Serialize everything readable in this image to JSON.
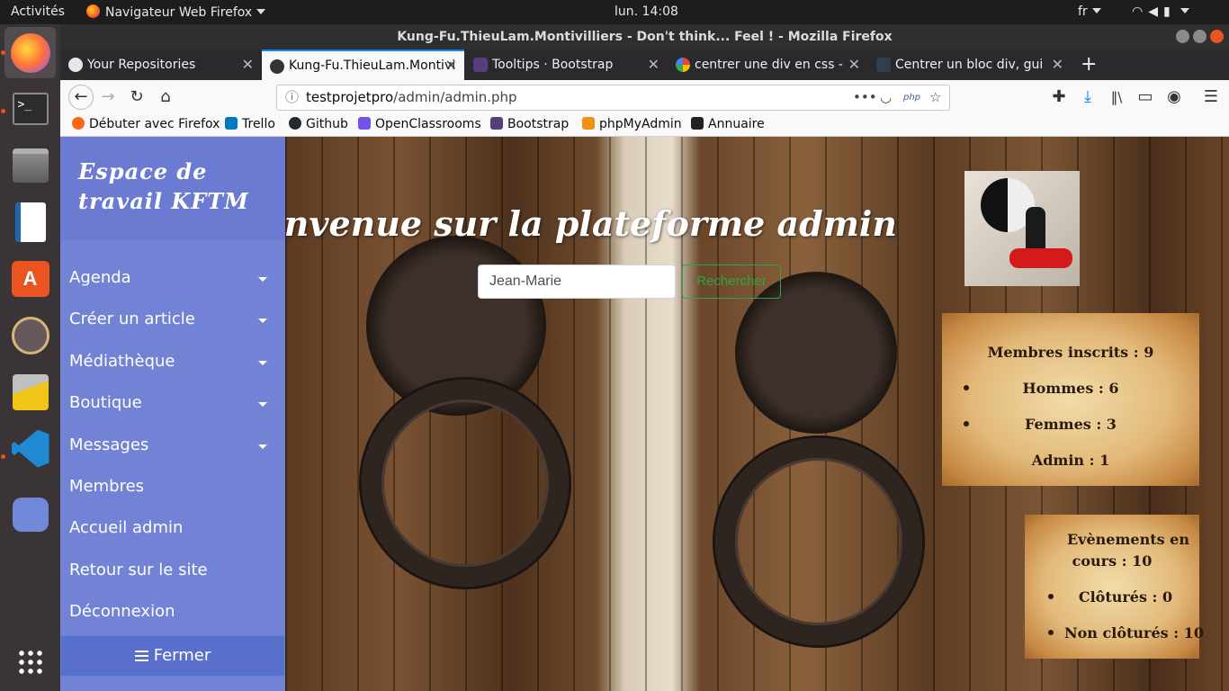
{
  "system": {
    "activities": "Activités",
    "app_menu": "Navigateur Web Firefox",
    "clock": "lun. 14:08",
    "keyboard_layout": "fr"
  },
  "dock": {
    "items": [
      "firefox-icon",
      "terminal-icon",
      "files-icon",
      "writer-icon",
      "software-icon",
      "atom-icon",
      "cleaner-icon",
      "vscode-icon",
      "discord-icon",
      "app-grid-icon"
    ]
  },
  "window": {
    "title": "Kung-Fu.ThieuLam.Montivilliers - Don't think... Feel ! - Mozilla Firefox"
  },
  "tabs": [
    {
      "label": "Your Repositories",
      "icon": "github-icon"
    },
    {
      "label": "Kung-Fu.ThieuLam.Montivi",
      "icon": "site-icon"
    },
    {
      "label": "Tooltips · Bootstrap",
      "icon": "bootstrap-icon"
    },
    {
      "label": "centrer une div en css - R",
      "icon": "google-icon"
    },
    {
      "label": "Centrer un bloc div, guide",
      "icon": "doc-icon"
    }
  ],
  "url": {
    "domain": "testprojetpro",
    "path": "/admin/admin.php"
  },
  "bookmarks": [
    {
      "label": "Débuter avec Firefox",
      "color": "#ff6611"
    },
    {
      "label": "Trello",
      "color": "#0079bf"
    },
    {
      "label": "Github",
      "color": "#24292e"
    },
    {
      "label": "OpenClassrooms",
      "color": "#7451eb"
    },
    {
      "label": "Bootstrap",
      "color": "#563d7c"
    },
    {
      "label": "phpMyAdmin",
      "color": "#f29111"
    },
    {
      "label": "Annuaire",
      "color": "#222222"
    }
  ],
  "sidebar": {
    "title_line1": "Espace de",
    "title_line2": "travail KFTM",
    "items": [
      {
        "label": "Agenda",
        "dropdown": true
      },
      {
        "label": "Créer un article",
        "dropdown": true
      },
      {
        "label": "Médiathèque",
        "dropdown": true
      },
      {
        "label": "Boutique",
        "dropdown": true
      },
      {
        "label": "Messages",
        "dropdown": true
      },
      {
        "label": "Membres",
        "dropdown": false
      },
      {
        "label": "Accueil admin",
        "dropdown": false
      },
      {
        "label": "Retour sur le site",
        "dropdown": false
      },
      {
        "label": "Déconnexion",
        "dropdown": false
      }
    ],
    "close_label": "Fermer"
  },
  "main": {
    "welcome": "Bienvenue sur la plateforme admin",
    "search_value": "Jean-Marie",
    "search_button": "Rechercher"
  },
  "stats": {
    "members": {
      "title": "Membres inscrits : 9",
      "men": "Hommes : 6",
      "women": "Femmes : 3",
      "admin": "Admin : 1"
    },
    "events": {
      "title_line1": "Evènements en",
      "title_line2": "cours : 10",
      "closed": "Clôturés : 0",
      "open": "Non clôturés : 10"
    }
  },
  "colors": {
    "sidebar": "#7283d6",
    "accent_tab": "#0a84ff",
    "search_button": "#28a745"
  }
}
